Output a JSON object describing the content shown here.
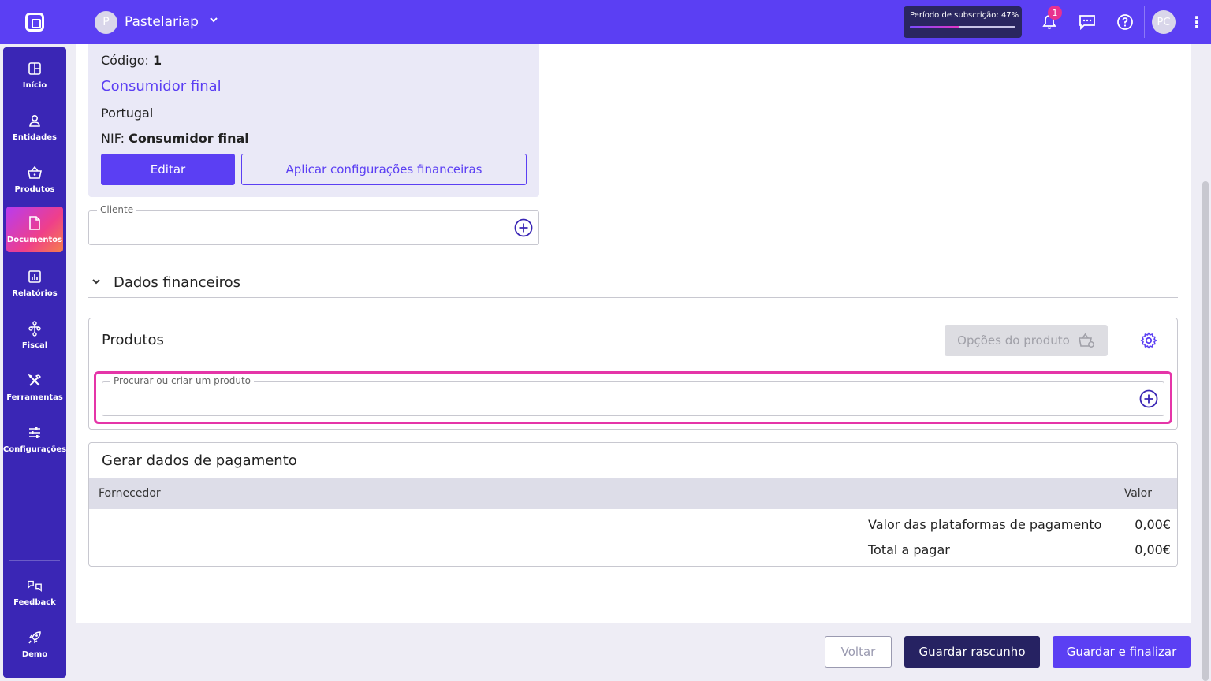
{
  "topbar": {
    "company_initial": "P",
    "company_name": "Pastelariap",
    "subscription_label": "Período de subscrição: 47%",
    "subscription_progress": 0.47,
    "notification_count": "1",
    "user_initials": "PC"
  },
  "sidebar": {
    "items": [
      {
        "label": "Início",
        "icon": "dashboard-icon"
      },
      {
        "label": "Entidades",
        "icon": "person-icon"
      },
      {
        "label": "Produtos",
        "icon": "basket-icon"
      },
      {
        "label": "Documentos",
        "icon": "document-icon",
        "active": true
      },
      {
        "label": "Relatórios",
        "icon": "chart-icon"
      },
      {
        "label": "Fiscal",
        "icon": "hierarchy-icon"
      },
      {
        "label": "Ferramentas",
        "icon": "tools-icon"
      },
      {
        "label": "Configurações",
        "icon": "sliders-icon"
      }
    ],
    "bottom_items": [
      {
        "label": "Feedback",
        "icon": "feedback-icon"
      },
      {
        "label": "Demo",
        "icon": "rocket-icon"
      }
    ]
  },
  "entity": {
    "code_label": "Código:",
    "code_value": "1",
    "name": "Consumidor final",
    "country": "Portugal",
    "nif_label": "NIF:",
    "nif_value": "Consumidor final",
    "edit_button": "Editar",
    "apply_button": "Aplicar configurações financeiras"
  },
  "client_field": {
    "label": "Cliente",
    "value": ""
  },
  "financial_section": {
    "title": "Dados financeiros"
  },
  "products": {
    "title": "Produtos",
    "options_button": "Opções do produto",
    "search_label": "Procurar ou criar um produto",
    "search_value": ""
  },
  "payment": {
    "title": "Gerar dados de pagamento",
    "col_supplier": "Fornecedor",
    "col_value": "Valor",
    "rows": [
      {
        "label": "Valor das plataformas de pagamento",
        "value": "0,00€"
      },
      {
        "label": "Total a pagar",
        "value": "0,00€"
      }
    ]
  },
  "footer": {
    "back_button": "Voltar",
    "draft_button": "Guardar rascunho",
    "finish_button": "Guardar e finalizar"
  },
  "colors": {
    "primary": "#5b3ff3",
    "sidebar": "#3a26b5",
    "dark": "#262262",
    "highlight": "#e535a8"
  }
}
